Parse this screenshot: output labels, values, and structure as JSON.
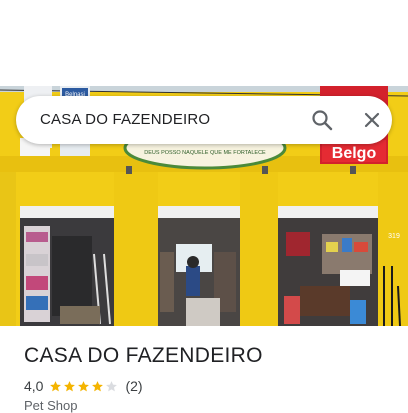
{
  "search": {
    "query": "CASA DO FAZENDEIRO"
  },
  "place": {
    "name": "CASA DO FAZENDEIRO",
    "rating": "4,0",
    "rating_stars": 4,
    "stars_max": 5,
    "review_count": "(2)",
    "category": "Pet Shop"
  },
  "photo_signs": {
    "banner_text": "DEUS POSSO NAQUELE QUE ME FORTALECE",
    "brand_sign": "Belgo",
    "top_tag": "Belnasi",
    "door_number": "319"
  },
  "colors": {
    "facade_yellow": "#f2cd17",
    "belgo_red": "#d3212c",
    "star_gold": "#f4b400",
    "star_empty": "#dadce0"
  },
  "icons": {
    "search": "search-icon",
    "close": "close-icon"
  }
}
